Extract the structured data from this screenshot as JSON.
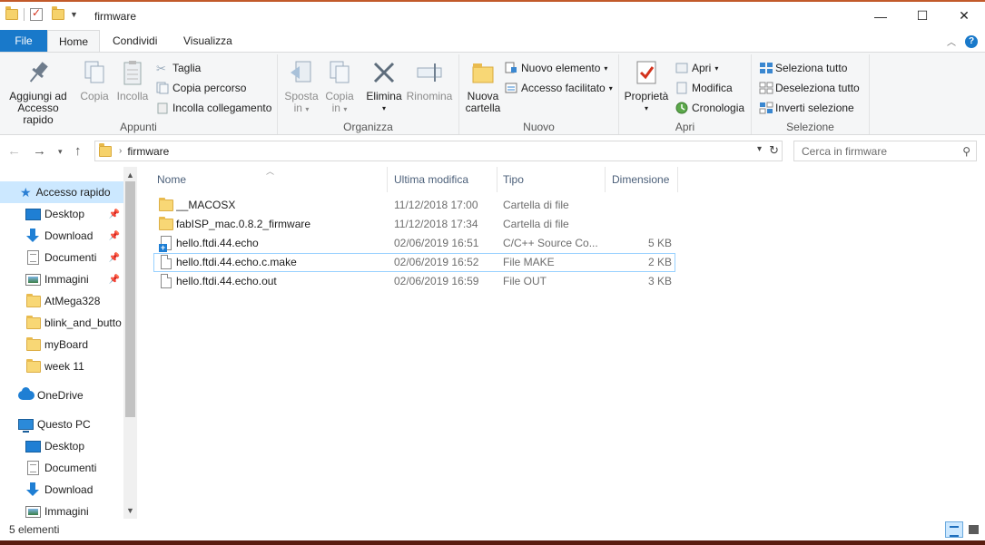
{
  "window": {
    "title": "firmware"
  },
  "quick_access_toolbar": {
    "icons": [
      "folder-icon",
      "properties-check-icon",
      "new-folder-icon",
      "customize-dropdown-icon"
    ]
  },
  "window_controls": {
    "minimize": "—",
    "maximize": "☐",
    "close": "✕"
  },
  "ribbon_tabs": [
    {
      "label": "File",
      "active": false
    },
    {
      "label": "Home",
      "active": true
    },
    {
      "label": "Condividi",
      "active": false
    },
    {
      "label": "Visualizza",
      "active": false
    }
  ],
  "ribbon": {
    "appunti": {
      "label": "Appunti",
      "pin_line1": "Aggiungi ad",
      "pin_line2": "Accesso rapido",
      "copy": "Copia",
      "paste": "Incolla",
      "cut": "Taglia",
      "copy_path": "Copia percorso",
      "paste_shortcut": "Incolla collegamento"
    },
    "organizza": {
      "label": "Organizza",
      "move_line1": "Sposta",
      "move_line2": "in",
      "copyto_line1": "Copia",
      "copyto_line2": "in",
      "delete": "Elimina",
      "rename": "Rinomina"
    },
    "nuovo": {
      "label": "Nuovo",
      "newfolder_line1": "Nuova",
      "newfolder_line2": "cartella",
      "new_item": "Nuovo elemento",
      "easy_access": "Accesso facilitato"
    },
    "apri": {
      "label": "Apri",
      "properties": "Proprietà",
      "open": "Apri",
      "edit": "Modifica",
      "history": "Cronologia"
    },
    "selezione": {
      "label": "Selezione",
      "select_all": "Seleziona tutto",
      "select_none": "Deseleziona tutto",
      "invert": "Inverti selezione"
    }
  },
  "address_bar": {
    "path": "firmware"
  },
  "search": {
    "placeholder": "Cerca in firmware"
  },
  "nav_pane": {
    "items": [
      {
        "label": "Accesso rapido",
        "icon": "star-icon",
        "pinned": false,
        "selected": true
      },
      {
        "label": "Desktop",
        "icon": "desktop-icon",
        "pinned": true
      },
      {
        "label": "Download",
        "icon": "download-icon",
        "pinned": true
      },
      {
        "label": "Documenti",
        "icon": "documents-icon",
        "pinned": true
      },
      {
        "label": "Immagini",
        "icon": "images-icon",
        "pinned": true
      },
      {
        "label": "AtMega328",
        "icon": "folder-icon"
      },
      {
        "label": "blink_and_butto",
        "icon": "folder-icon"
      },
      {
        "label": "myBoard",
        "icon": "folder-icon"
      },
      {
        "label": "week 11",
        "icon": "folder-icon"
      },
      {
        "label": "OneDrive",
        "icon": "onedrive-icon"
      },
      {
        "label": "Questo PC",
        "icon": "pc-icon"
      },
      {
        "label": "Desktop",
        "icon": "desktop-icon"
      },
      {
        "label": "Documenti",
        "icon": "documents-icon"
      },
      {
        "label": "Download",
        "icon": "download-icon"
      },
      {
        "label": "Immagini",
        "icon": "images-icon"
      }
    ]
  },
  "file_list": {
    "columns": {
      "name": "Nome",
      "modified": "Ultima modifica",
      "type": "Tipo",
      "size": "Dimensione"
    },
    "rows": [
      {
        "name": "__MACOSX",
        "modified": "11/12/2018 17:00",
        "type": "Cartella di file",
        "size": "",
        "icon": "folder-icon"
      },
      {
        "name": "fabISP_mac.0.8.2_firmware",
        "modified": "11/12/2018 17:34",
        "type": "Cartella di file",
        "size": "",
        "icon": "folder-icon"
      },
      {
        "name": "hello.ftdi.44.echo",
        "modified": "02/06/2019 16:51",
        "type": "C/C++ Source Co...",
        "size": "5 KB",
        "icon": "c-source-file-icon"
      },
      {
        "name": "hello.ftdi.44.echo.c.make",
        "modified": "02/06/2019 16:52",
        "type": "File MAKE",
        "size": "2 KB",
        "icon": "file-icon",
        "selected": true
      },
      {
        "name": "hello.ftdi.44.echo.out",
        "modified": "02/06/2019 16:59",
        "type": "File OUT",
        "size": "3 KB",
        "icon": "file-icon"
      }
    ]
  },
  "status_bar": {
    "count": "5 elementi"
  }
}
